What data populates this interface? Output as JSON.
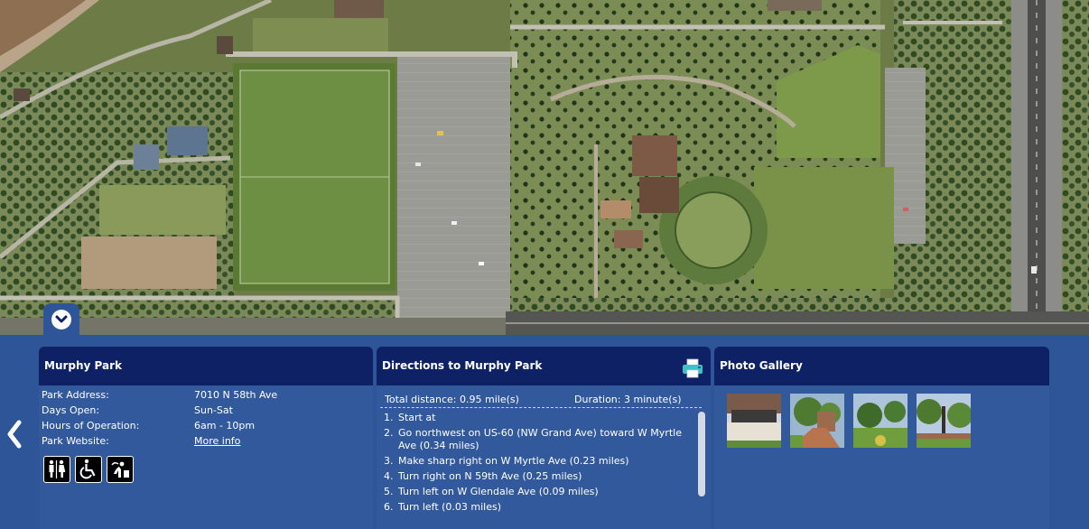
{
  "map": {
    "background": "aerial-satellite-image"
  },
  "controls": {
    "collapse_icon": "chevron-down-circle-icon",
    "prev_icon": "chevron-left-icon"
  },
  "park_card": {
    "title": "Murphy Park",
    "rows": [
      {
        "label": "Park Address:",
        "value": "7010 N 58th Ave"
      },
      {
        "label": "Days Open:",
        "value": "Sun-Sat"
      },
      {
        "label": "Hours of Operation:",
        "value": "6am - 10pm"
      },
      {
        "label": "Park Website:",
        "value": "More info"
      }
    ],
    "amenities": [
      "restroom-icon",
      "wheelchair-accessible-icon",
      "drinking-fountain-icon"
    ]
  },
  "directions_card": {
    "title": "Directions to Murphy Park",
    "print_icon": "printer-icon",
    "total_distance": "Total distance: 0.95 mile(s)",
    "duration": "Duration: 3 minute(s)",
    "steps": [
      {
        "num": "1.",
        "text": "Start at"
      },
      {
        "num": "2.",
        "text": "Go northwest on US-60 (NW Grand Ave) toward W Myrtle Ave (0.34 miles)"
      },
      {
        "num": "3.",
        "text": "Make sharp right on W Myrtle Ave (0.23 miles)"
      },
      {
        "num": "4.",
        "text": "Turn right on N 59th Ave (0.25 miles)"
      },
      {
        "num": "5.",
        "text": "Turn left on W Glendale Ave (0.09 miles)"
      },
      {
        "num": "6.",
        "text": "Turn left (0.03 miles)"
      }
    ]
  },
  "photo_card": {
    "title": "Photo Gallery",
    "photos": [
      "photo-thumbnail-1",
      "photo-thumbnail-2",
      "photo-thumbnail-3",
      "photo-thumbnail-4"
    ]
  },
  "colors": {
    "panel": "#2e5597",
    "header": "#0e2164",
    "text": "#ffffff"
  }
}
